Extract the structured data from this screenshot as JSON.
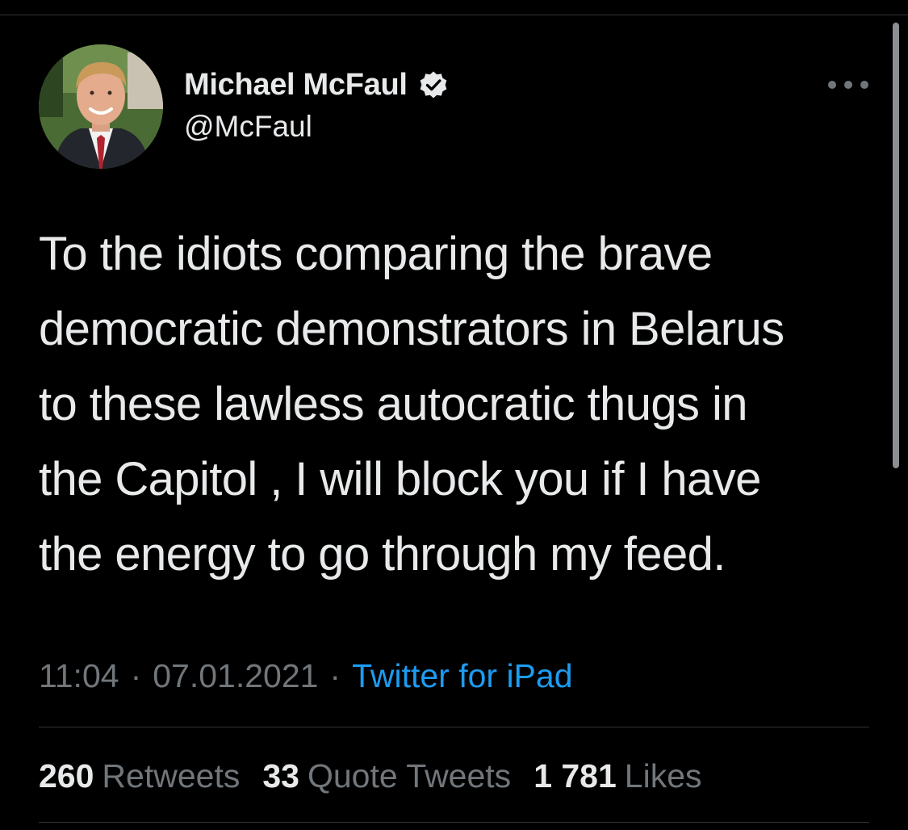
{
  "author": {
    "display_name": "Michael McFaul",
    "handle": "@McFaul",
    "verified": true,
    "avatar": "profile-photo"
  },
  "tweet": {
    "text": "To the idiots comparing the brave\ndemocratic demonstrators in Belarus\nto these lawless autocratic thugs in\nthe Capitol , I will block you if I have\nthe energy to go through my feed.",
    "time": "11:04",
    "separator": "·",
    "date": "07.01.2021",
    "source": "Twitter for iPad"
  },
  "stats": {
    "retweets": {
      "count": "260",
      "label": "Retweets"
    },
    "quote_tweets": {
      "count": "33",
      "label": "Quote Tweets"
    },
    "likes": {
      "count": "1 781",
      "label": "Likes"
    }
  },
  "icons": {
    "more": "more-horizontal-icon",
    "verified": "verified-badge-icon"
  },
  "colors": {
    "background": "#000000",
    "primary_text": "#e7e9ea",
    "secondary_text": "#71767b",
    "link": "#1d9bf0",
    "divider": "#2f3336"
  }
}
